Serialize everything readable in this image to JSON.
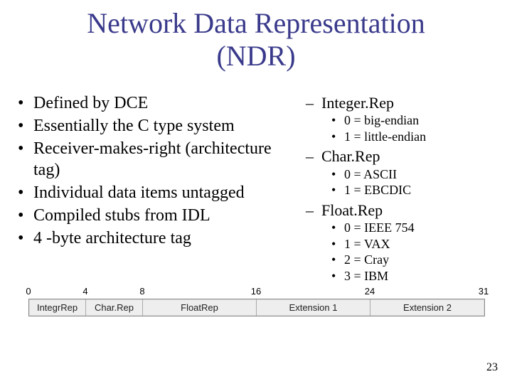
{
  "title_line1": "Network Data Representation",
  "title_line2": "(NDR)",
  "left_bullets": [
    "Defined by DCE",
    "Essentially the C type system",
    "Receiver-makes-right (architecture tag)",
    "Individual data items untagged",
    "Compiled stubs from IDL",
    "4 -byte architecture tag"
  ],
  "right": {
    "items": [
      {
        "label": "Integer.Rep",
        "subs": [
          "0 = big-endian",
          "1 = little-endian"
        ]
      },
      {
        "label": "Char.Rep",
        "subs": [
          "0 = ASCII",
          "1 = EBCDIC"
        ]
      },
      {
        "label": "Float.Rep",
        "subs": [
          "0 = IEEE 754",
          "1 = VAX",
          "2 = Cray",
          "3 = IBM"
        ]
      }
    ]
  },
  "diagram": {
    "ticks": [
      "0",
      "4",
      "8",
      "16",
      "24",
      "31"
    ],
    "cells": [
      "IntegrRep",
      "Char.Rep",
      "FloatRep",
      "Extension 1",
      "Extension 2"
    ]
  },
  "page_number": "23"
}
